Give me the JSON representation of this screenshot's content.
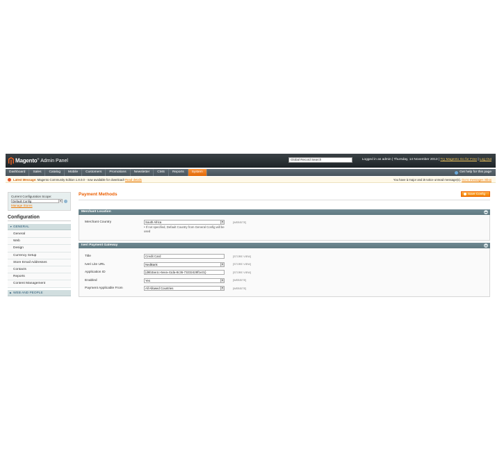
{
  "header": {
    "logo_text": "Magento",
    "logo_sup": "®",
    "logo_admin": "Admin Panel",
    "search_value": "Global Record Search",
    "login_text": "Logged in as admin | Thursday, 14 November 2013 | ",
    "try_link": "Try Magento Go for Free",
    "separator": " | ",
    "logout_link": "Log Out"
  },
  "nav": {
    "items": [
      "Dashboard",
      "Sales",
      "Catalog",
      "Mobile",
      "Customers",
      "Promotions",
      "Newsletter",
      "CMS",
      "Reports",
      "System"
    ],
    "active": "System",
    "help_label": "Get help for this page"
  },
  "message": {
    "latest_label": "Latest Message:",
    "latest_text": " Magento Community Edition 1.8.0.0 - now available for download! ",
    "read_details": "Read details",
    "right_text_1": "You have ",
    "major_count": "1",
    "right_text_2": " major and ",
    "notice_count": "3",
    "right_text_3": " notice unread message(s). ",
    "inbox_link": "Go to messages inbox"
  },
  "sidebar": {
    "scope_label": "Current Configuration Scope:",
    "scope_value": "Default Config",
    "manage_stores": "Manage Stores",
    "title": "Configuration",
    "general_section": "GENERAL",
    "items": [
      "General",
      "Web",
      "Design",
      "Currency Setup",
      "Store Email Addresses",
      "Contacts",
      "Reports",
      "Content Management"
    ],
    "next_section": "WEB AND PEOPLE"
  },
  "main": {
    "title": "Payment Methods",
    "save_label": "Save Config",
    "merchant_fieldset": {
      "title": "Merchant Location",
      "country_label": "Merchant Country",
      "country_value": "South Africa",
      "country_note": "If not specified, Default Country from General Config will be used",
      "country_scope": "[WEBSITE]"
    },
    "gateway_fieldset": {
      "title": "Iveri Payment Gateway",
      "rows": [
        {
          "label": "Title",
          "value": "Credit Card",
          "type": "input",
          "scope": "[STORE VIEW]"
        },
        {
          "label": "Iveri Lite URL",
          "value": "NedBank",
          "type": "select",
          "scope": "[STORE VIEW]"
        },
        {
          "label": "Application ID",
          "value": "{d6b3ae1c-6eea-41da-8c36-73232428f1e31}",
          "type": "input",
          "scope": "[STORE VIEW]"
        },
        {
          "label": "Enabled",
          "value": "Yes",
          "type": "select",
          "scope": "[WEBSITE]"
        },
        {
          "label": "Payment Applicable From",
          "value": "All Allowed Countries",
          "type": "select",
          "scope": "[WEBSITE]"
        }
      ]
    }
  },
  "colors": {
    "accent_orange": "#eb5e00",
    "header_dark": "#2b3236",
    "nav_gray": "#56626a",
    "fieldset_head": "#6a848c"
  }
}
